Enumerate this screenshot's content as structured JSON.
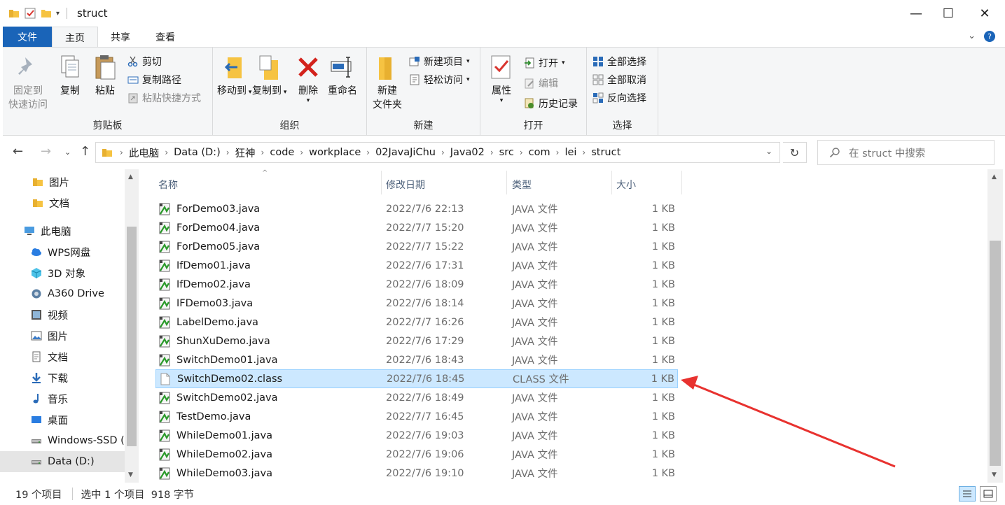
{
  "window": {
    "title": "struct",
    "minimize": "—",
    "maximize": "☐",
    "close": "✕"
  },
  "ribbon_tabs": [
    {
      "label": "文件"
    },
    {
      "label": "主页"
    },
    {
      "label": "共享"
    },
    {
      "label": "查看"
    }
  ],
  "clipboard": {
    "pin": "固定到",
    "pin2": "快速访问",
    "copy": "复制",
    "paste": "粘贴",
    "cut": "剪切",
    "copy_path": "复制路径",
    "paste_shortcut": "粘贴快捷方式",
    "group": "剪贴板"
  },
  "organize": {
    "move_to": "移动到",
    "copy_to": "复制到",
    "delete": "删除",
    "rename": "重命名",
    "group": "组织"
  },
  "new": {
    "new_folder": "新建",
    "new_folder2": "文件夹",
    "new_item": "新建项目",
    "easy_access": "轻松访问",
    "group": "新建"
  },
  "open": {
    "properties": "属性",
    "open": "打开",
    "edit": "编辑",
    "history": "历史记录",
    "group": "打开"
  },
  "select": {
    "select_all": "全部选择",
    "select_none": "全部取消",
    "invert": "反向选择",
    "group": "选择"
  },
  "address": {
    "crumbs": [
      "此电脑",
      "Data (D:)",
      "狂神",
      "code",
      "workplace",
      "02JavaJiChu",
      "Java02",
      "src",
      "com",
      "lei",
      "struct"
    ]
  },
  "search": {
    "placeholder": "在 struct 中搜索"
  },
  "nav": [
    {
      "label": "图片",
      "icon": "folder-icon"
    },
    {
      "label": "文档",
      "icon": "folder-icon"
    },
    {
      "label": "此电脑",
      "icon": "computer-icon"
    },
    {
      "label": "WPS网盘",
      "icon": "cloud-icon"
    },
    {
      "label": "3D 对象",
      "icon": "cube-icon"
    },
    {
      "label": "A360 Drive",
      "icon": "drive-icon"
    },
    {
      "label": "视频",
      "icon": "video-icon"
    },
    {
      "label": "图片",
      "icon": "pictures-icon"
    },
    {
      "label": "文档",
      "icon": "documents-icon"
    },
    {
      "label": "下载",
      "icon": "download-icon"
    },
    {
      "label": "音乐",
      "icon": "music-icon"
    },
    {
      "label": "桌面",
      "icon": "desktop-icon"
    },
    {
      "label": "Windows-SSD (",
      "icon": "disk-icon"
    },
    {
      "label": "Data (D:)",
      "icon": "disk-icon"
    }
  ],
  "columns": {
    "name": "名称",
    "date": "修改日期",
    "type": "类型",
    "size": "大小"
  },
  "files": [
    {
      "name": "ForDemo03.java",
      "date": "2022/7/6 22:13",
      "type": "JAVA 文件",
      "size": "1 KB"
    },
    {
      "name": "ForDemo04.java",
      "date": "2022/7/7 15:20",
      "type": "JAVA 文件",
      "size": "1 KB"
    },
    {
      "name": "ForDemo05.java",
      "date": "2022/7/7 15:22",
      "type": "JAVA 文件",
      "size": "1 KB"
    },
    {
      "name": "IfDemo01.java",
      "date": "2022/7/6 17:31",
      "type": "JAVA 文件",
      "size": "1 KB"
    },
    {
      "name": "IfDemo02.java",
      "date": "2022/7/6 18:09",
      "type": "JAVA 文件",
      "size": "1 KB"
    },
    {
      "name": "IFDemo03.java",
      "date": "2022/7/6 18:14",
      "type": "JAVA 文件",
      "size": "1 KB"
    },
    {
      "name": "LabelDemo.java",
      "date": "2022/7/7 16:26",
      "type": "JAVA 文件",
      "size": "1 KB"
    },
    {
      "name": "ShunXuDemo.java",
      "date": "2022/7/6 17:29",
      "type": "JAVA 文件",
      "size": "1 KB"
    },
    {
      "name": "SwitchDemo01.java",
      "date": "2022/7/6 18:43",
      "type": "JAVA 文件",
      "size": "1 KB"
    },
    {
      "name": "SwitchDemo02.class",
      "date": "2022/7/6 18:45",
      "type": "CLASS 文件",
      "size": "1 KB",
      "selected": true
    },
    {
      "name": "SwitchDemo02.java",
      "date": "2022/7/6 18:49",
      "type": "JAVA 文件",
      "size": "1 KB"
    },
    {
      "name": "TestDemo.java",
      "date": "2022/7/7 16:45",
      "type": "JAVA 文件",
      "size": "1 KB"
    },
    {
      "name": "WhileDemo01.java",
      "date": "2022/7/6 19:03",
      "type": "JAVA 文件",
      "size": "1 KB"
    },
    {
      "name": "WhileDemo02.java",
      "date": "2022/7/6 19:06",
      "type": "JAVA 文件",
      "size": "1 KB"
    },
    {
      "name": "WhileDemo03.java",
      "date": "2022/7/6 19:10",
      "type": "JAVA 文件",
      "size": "1 KB"
    }
  ],
  "status": {
    "count": "19 个项目",
    "selection": "选中 1 个项目  918 字节"
  },
  "colors": {
    "file_tab": "#1a64b8",
    "selected_row": "#cce8ff",
    "annotation_arrow": "#e8322f"
  }
}
